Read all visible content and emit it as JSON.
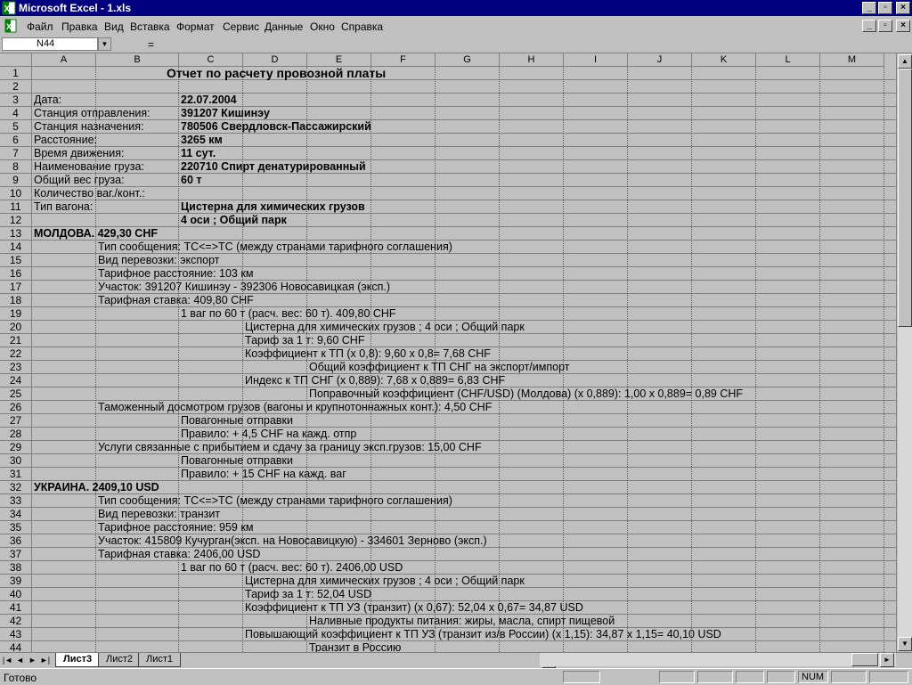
{
  "window": {
    "title": "Microsoft Excel - 1.xls"
  },
  "menu": [
    "Файл",
    "Правка",
    "Вид",
    "Вставка",
    "Формат",
    "Сервис",
    "Данные",
    "Окно",
    "Справка"
  ],
  "formula_bar": {
    "name_box": "N44",
    "equals": "=",
    "content": ""
  },
  "columns": [
    "A",
    "B",
    "C",
    "D",
    "E",
    "F",
    "G",
    "H",
    "I",
    "J",
    "K",
    "L",
    "M"
  ],
  "rows": [
    "1",
    "2",
    "3",
    "4",
    "5",
    "6",
    "7",
    "8",
    "9",
    "10",
    "11",
    "12",
    "13",
    "14",
    "15",
    "16",
    "17",
    "18",
    "19",
    "20",
    "21",
    "22",
    "23",
    "24",
    "25",
    "26",
    "27",
    "28",
    "29",
    "30",
    "31",
    "32",
    "33",
    "34",
    "35",
    "36",
    "37",
    "38",
    "39",
    "40",
    "41",
    "42",
    "43",
    "44"
  ],
  "sheet": {
    "r1": "Отчет по расчету провозной платы",
    "r3a": "Дата:",
    "r3c": "22.07.2004",
    "r4a": "Станция отправления:",
    "r4c": " 391207  Кишинэу",
    "r5a": "Станция назначения:",
    "r5c": " 780506  Свердловск-Пассажирский",
    "r6a": "Расстояние:",
    "r6c": "3265  км",
    "r7a": "Время движения:",
    "r7c": " 11 сут.",
    "r8a": "Наименование груза:",
    "r8c": " 220710 Спирт денатурированный",
    "r9a": "Общий вес груза:",
    "r9c": " 60 т",
    "r10a": "Количество ваг./конт.:",
    "r11a": "Тип вагона:",
    "r11c": "Цистерна для химических грузов",
    "r12c": " 4 оси ; Общий парк",
    "r13a": "МОЛДОВА. 429,30 CHF",
    "r14b": "Тип сообщения: ТС<=>ТС (между странами тарифного соглашения)",
    "r15b": "Вид перевозки: экспорт",
    "r16b": "Тарифное расстояние: 103 км",
    "r17b": "Участок: 391207  Кишинэу - 392306  Новосавицкая (эксп.)",
    "r18b": "Тарифная ставка: 409,80 CHF",
    "r19c": "1 ваг по 60 т (расч. вес: 60 т). 409,80 CHF",
    "r20d": "Цистерна для химических грузов ; 4 оси ; Общий парк",
    "r21d": "Тариф за 1 т: 9,60 CHF",
    "r22d": "Коэффициент к ТП (х 0,8):  9,60 х 0,8= 7,68 CHF",
    "r23e": "Общий коэффициент к ТП СНГ на экспорт/импорт",
    "r24d": "Индекс к ТП СНГ (х 0,889):  7,68 х 0,889= 6,83 CHF",
    "r25e": "Поправочный коэффициент (CHF/USD) (Молдова) (х 0,889):  1,00 х 0,889= 0,89 CHF",
    "r26b": "Таможенный досмотром грузов (вагоны и крупнотоннажных конт.):  4,50 CHF",
    "r27c": "Повагонные отправки",
    "r28c": "Правило: + 4,5 CHF на кажд. отпр",
    "r29b": "Услуги связанные с прибытием и сдачу за границу эксп.грузов:  15,00 CHF",
    "r30c": "Повагонные отправки",
    "r31c": "Правило: + 15 CHF на кажд. ваг",
    "r32a": "УКРАИНА. 2409,10 USD",
    "r33b": "Тип сообщения: ТС<=>ТС (между странами тарифного соглашения)",
    "r34b": "Вид перевозки: транзит",
    "r35b": "Тарифное расстояние: 959 км",
    "r36b": "Участок: 415809  Кучурган(эксп. на Новосавицкую) - 334601  Зерново (эксп.)",
    "r37b": "Тарифная ставка: 2406,00 USD",
    "r38c": "1 ваг по 60 т (расч. вес: 60 т). 2406,00 USD",
    "r39d": "Цистерна для химических грузов ; 4 оси ; Общий парк",
    "r40d": "Тариф за 1 т: 52,04 USD",
    "r41d": "Коэффициент к ТП УЗ (транзит) (х 0,67):  52,04 х 0,67= 34,87 USD",
    "r42e": "Наливные продукты питания: жиры, масла, спирт пищевой",
    "r43d": "Повышающий коэффициент к ТП УЗ (транзит из/в России) (х 1,15):  34,87 х 1,15= 40,10 USD",
    "r44e": "Транзит в Россию"
  },
  "tabs": [
    "Лист3",
    "Лист2",
    "Лист1"
  ],
  "active_tab": "Лист3",
  "status": {
    "text": "Готово",
    "num": "NUM"
  }
}
